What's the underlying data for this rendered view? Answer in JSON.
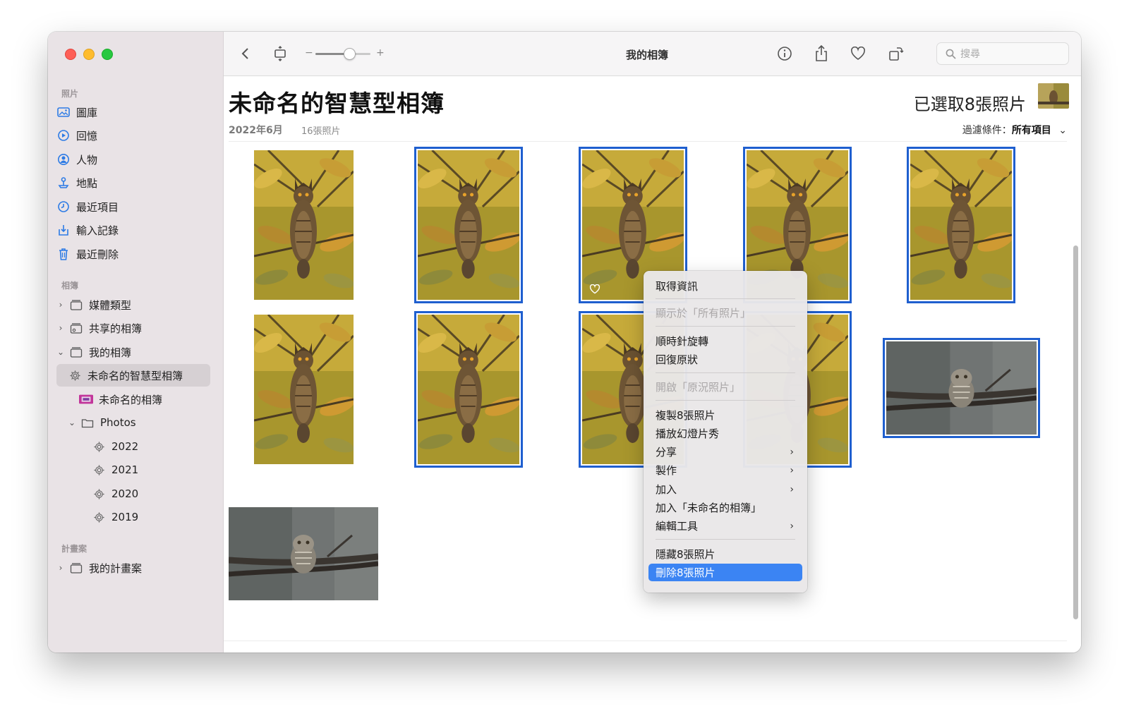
{
  "window": {
    "title": "我的相簿",
    "search_placeholder": "搜尋"
  },
  "sidebar": {
    "photos_section": "照片",
    "photos_items": [
      {
        "label": "圖庫",
        "icon": "photo-library-icon"
      },
      {
        "label": "回憶",
        "icon": "memories-icon"
      },
      {
        "label": "人物",
        "icon": "people-icon"
      },
      {
        "label": "地點",
        "icon": "places-icon"
      },
      {
        "label": "最近項目",
        "icon": "recents-icon"
      },
      {
        "label": "輸入記錄",
        "icon": "imports-icon"
      },
      {
        "label": "最近刪除",
        "icon": "trash-icon"
      }
    ],
    "albums_section": "相簿",
    "album_items": [
      {
        "label": "媒體類型"
      },
      {
        "label": "共享的相簿"
      },
      {
        "label": "我的相簿"
      },
      {
        "label": "未命名的智慧型相簿"
      },
      {
        "label": "未命名的相簿"
      },
      {
        "label": "Photos"
      },
      {
        "label": "2022"
      },
      {
        "label": "2021"
      },
      {
        "label": "2020"
      },
      {
        "label": "2019"
      }
    ],
    "projects_section": "計畫案",
    "project_items": [
      {
        "label": "我的計畫案"
      }
    ]
  },
  "toolbar": {
    "zoom_minus": "−",
    "zoom_plus": "+",
    "zoom_level": 0.62
  },
  "album": {
    "title": "未命名的智慧型相簿",
    "date": "2022年6月",
    "count": "16張照片",
    "selected": "已選取8張照片",
    "filter_label": "過濾條件：",
    "filter_value": "所有項目"
  },
  "context_menu": {
    "items": [
      {
        "label": "取得資訊",
        "enabled": true
      },
      {
        "label": "顯示於「所有照片」",
        "enabled": false
      },
      {
        "label": "順時針旋轉",
        "enabled": true
      },
      {
        "label": "回復原狀",
        "enabled": true
      },
      {
        "label": "開啟「原況照片」",
        "enabled": false
      },
      {
        "label": "複製8張照片",
        "enabled": true
      },
      {
        "label": "播放幻燈片秀",
        "enabled": true
      },
      {
        "label": "分享",
        "enabled": true,
        "submenu": true
      },
      {
        "label": "製作",
        "enabled": true,
        "submenu": true
      },
      {
        "label": "加入",
        "enabled": true,
        "submenu": true
      },
      {
        "label": "加入「未命名的相簿」",
        "enabled": true
      },
      {
        "label": "編輯工具",
        "enabled": true,
        "submenu": true
      },
      {
        "label": "隱藏8張照片",
        "enabled": true
      },
      {
        "label": "刪除8張照片",
        "enabled": true,
        "highlighted": true
      }
    ]
  },
  "colors": {
    "selection": "#1f5fcf",
    "menu_highlight": "#3b84f3",
    "sidebar_bg": "#e9e3e6",
    "accent_icon": "#2d7be5"
  }
}
